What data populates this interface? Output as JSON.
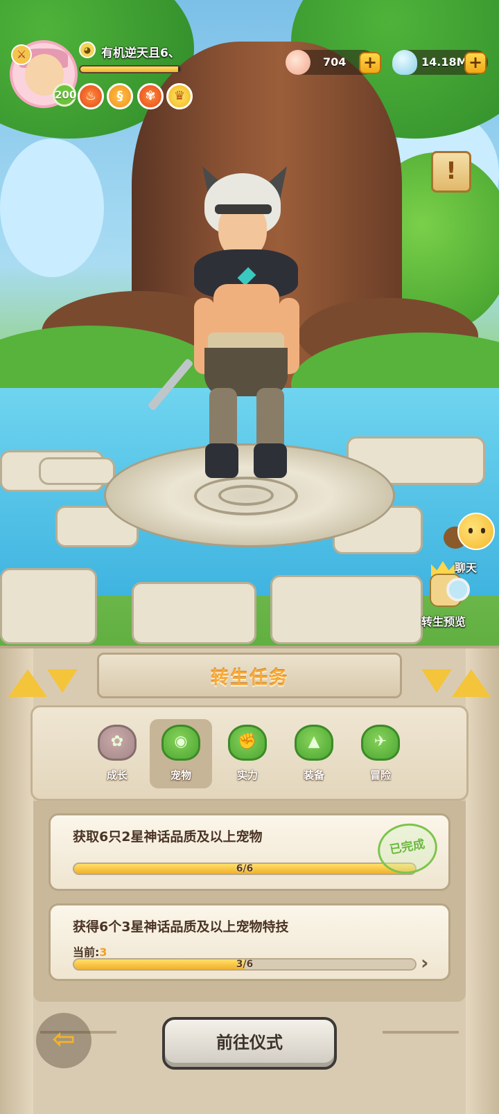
{
  "player": {
    "name": "有机逆天且6、",
    "level": "200",
    "exp_fraction": 0.98
  },
  "resources": {
    "shells": {
      "value": "704",
      "icon": "seashell-icon",
      "color": "#f6b8a0"
    },
    "slime": {
      "value": "14.18M",
      "icon": "slime-gem-icon",
      "color": "#9fd8ee"
    }
  },
  "buffs": [
    {
      "icon": "rooster-icon"
    },
    {
      "icon": "spiral-icon"
    },
    {
      "icon": "beetle-icon"
    },
    {
      "icon": "crown-icon"
    }
  ],
  "side": {
    "chat_label": "聊天",
    "rebirth_preview_label": "转生预览"
  },
  "panel": {
    "title": "转生任务",
    "tabs": [
      {
        "label": "成长",
        "icon": "growth-icon",
        "active": false
      },
      {
        "label": "宠物",
        "icon": "pet-icon",
        "active": true
      },
      {
        "label": "实力",
        "icon": "strength-icon",
        "active": false
      },
      {
        "label": "装备",
        "icon": "equipment-icon",
        "active": false
      },
      {
        "label": "冒险",
        "icon": "adventure-icon",
        "active": false
      }
    ],
    "quests": [
      {
        "title": "获取6只2星神话品质及以上宠物",
        "progress_text": "6/6",
        "progress": 1.0,
        "stamp": "已完成"
      },
      {
        "title": "获得6个3星神话品质及以上宠物特技",
        "current_label": "当前:",
        "current_value": "3",
        "progress_text": "3/6",
        "progress": 0.5
      }
    ],
    "go_button": "前往仪式"
  },
  "colors": {
    "accent_gold": "#f4c43a",
    "title_orange": "#f7a93a",
    "tab_green": "#4aa632",
    "panel_bg": "#d9cbb2"
  }
}
